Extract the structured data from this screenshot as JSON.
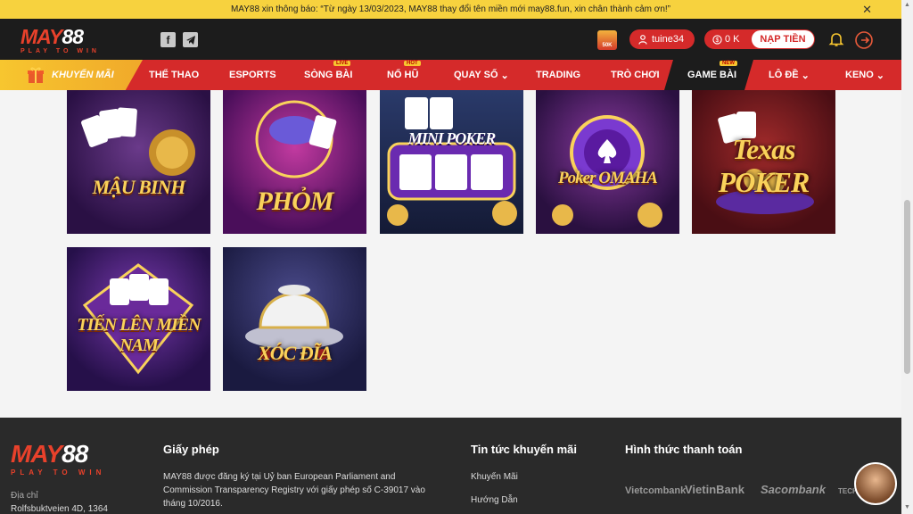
{
  "notice": {
    "text": "MAY88 xin thông báo: “Từ ngày 13/03/2023, MAY88 thay đổi tên miền mới may88.fun, xin chân thành cảm ơn!”",
    "close": "✕"
  },
  "header": {
    "logo_top": "MAY",
    "logo_num": "88",
    "logo_tag": "PLAY TO WIN",
    "facebook": "f",
    "gift_label": "50K",
    "username": "tuine34",
    "balance": "0 K",
    "deposit": "NẠP TIỀN"
  },
  "nav": {
    "promo": "KHUYẾN MÃI",
    "items": [
      {
        "label": "THỂ THAO"
      },
      {
        "label": "ESPORTS"
      },
      {
        "label": "SÒNG BÀI",
        "badge": "LIVE"
      },
      {
        "label": "NỔ HŨ",
        "badge": "HOT"
      },
      {
        "label": "QUAY SỐ",
        "caret": "⌄"
      },
      {
        "label": "TRADING"
      },
      {
        "label": "TRÒ CHƠI"
      },
      {
        "label": "GAME BÀI",
        "badge": "NEW"
      },
      {
        "label": "LÔ ĐỀ",
        "caret": "⌄"
      },
      {
        "label": "KENO",
        "caret": "⌄"
      }
    ]
  },
  "games": [
    {
      "name": "MẬU BINH",
      "bg": "#3a1c5c"
    },
    {
      "name": "PHỎM",
      "bg": "#5a1466"
    },
    {
      "name": "MINI POKER",
      "bg": "#1b2a55"
    },
    {
      "name": "Poker OMAHA",
      "bg": "#3a1a52"
    },
    {
      "name": "Texas POKER",
      "bg": "#6a1818"
    },
    {
      "name": "TIẾN LÊN MIỀN NAM",
      "bg": "#3b1660"
    },
    {
      "name": "XÓC ĐĨA",
      "bg": "#26285a"
    }
  ],
  "footer": {
    "logo_top": "MAY",
    "logo_num": "88",
    "logo_tag": "PLAY TO WIN",
    "address_label": "Địa chỉ",
    "address": "Rolfsbuktveien 4D, 1364",
    "license_title": "Giấy phép",
    "license_text_1": "MAY88 được đăng ký tại Uỷ ban European Parliament and",
    "license_text_2": "Commission Transparency Registry với giấy phép số C-39017 vào",
    "license_text_3": "tháng 10/2016.",
    "news_title": "Tin tức khuyến mãi",
    "news_1": "Khuyến Mãi",
    "news_2": "Hướng Dẫn",
    "payment_title": "Hình thức thanh toán",
    "banks": [
      "Vietcombank",
      "VietinBank",
      "Sacombank",
      "TECHC"
    ]
  },
  "colors": {
    "brand_red": "#d52a2a",
    "notice_yellow": "#f7d23e",
    "header_dark": "#1c1c1c",
    "footer_dark": "#2a2a2a"
  }
}
